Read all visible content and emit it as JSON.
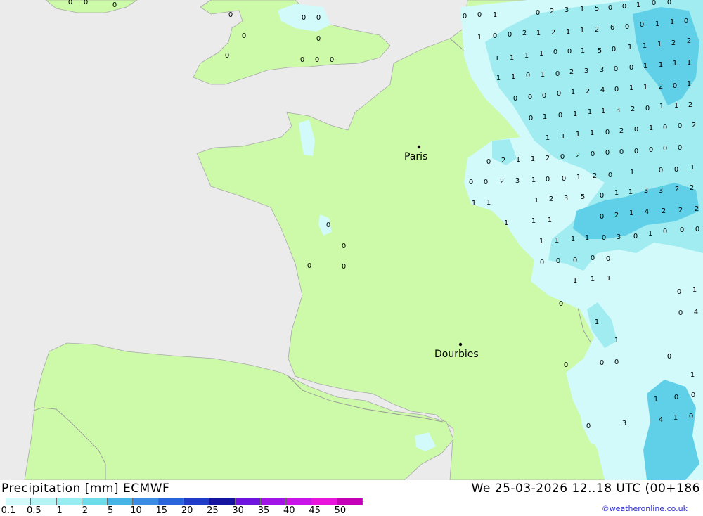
{
  "map": {
    "colors": {
      "sea": "#ebebeb",
      "land": "#ccfaa8",
      "precip_light": "#d2fafa",
      "precip_mid": "#a0ecf0",
      "precip_heavy": "#60d0e8",
      "border": "#9a9a9a"
    },
    "cities": [
      {
        "name": "Paris"
      },
      {
        "name": "Dourbies"
      }
    ]
  },
  "values": [
    "0",
    "0",
    "0",
    "0",
    "0",
    "0",
    "0",
    "0",
    "0",
    "0",
    "0",
    "0",
    "0",
    "0",
    "0",
    "0",
    "0",
    "0",
    "1",
    "0",
    "2",
    "3",
    "1",
    "5",
    "0",
    "0",
    "1",
    "0",
    "0",
    "1",
    "0",
    "0",
    "2",
    "1",
    "2",
    "1",
    "1",
    "2",
    "6",
    "0",
    "0",
    "1",
    "1",
    "0",
    "1",
    "1",
    "1",
    "1",
    "0",
    "0",
    "1",
    "5",
    "0",
    "1",
    "1",
    "1",
    "2",
    "2",
    "1",
    "1",
    "0",
    "1",
    "0",
    "2",
    "3",
    "3",
    "0",
    "0",
    "1",
    "1",
    "1",
    "1",
    "0",
    "0",
    "0",
    "0",
    "1",
    "2",
    "4",
    "0",
    "1",
    "1",
    "2",
    "0",
    "1",
    "0",
    "1",
    "0",
    "1",
    "1",
    "1",
    "3",
    "2",
    "0",
    "1",
    "1",
    "2",
    "1",
    "1",
    "1",
    "1",
    "0",
    "2",
    "0",
    "1",
    "0",
    "0",
    "2",
    "0",
    "2",
    "1",
    "1",
    "2",
    "0",
    "2",
    "0",
    "0",
    "0",
    "0",
    "0",
    "0",
    "0",
    "0",
    "0",
    "2",
    "3",
    "1",
    "0",
    "0",
    "1",
    "2",
    "0",
    "1",
    "0",
    "0",
    "1",
    "1",
    "1",
    "1",
    "2",
    "3",
    "5",
    "0",
    "1",
    "1",
    "3",
    "3",
    "2",
    "2",
    "1",
    "1",
    "1",
    "0",
    "2",
    "1",
    "4",
    "2",
    "2",
    "2",
    "1",
    "1",
    "1",
    "1",
    "0",
    "3",
    "0",
    "1",
    "0",
    "0",
    "0",
    "0",
    "0",
    "0",
    "0",
    "0",
    "1",
    "1",
    "1",
    "0",
    "0",
    "1",
    "0",
    "4",
    "1",
    "1",
    "0",
    "0",
    "0",
    "0",
    "1",
    "1",
    "0",
    "0",
    "0",
    "3",
    "4",
    "1",
    "0"
  ],
  "footer": {
    "title": "Precipitation [mm] ECMWF",
    "datetime": "We 25-03-2026 12..18 UTC (00+186",
    "credit": "©weatheronline.co.uk",
    "legend": {
      "labels": [
        "0.1",
        "0.5",
        "1",
        "2",
        "5",
        "10",
        "15",
        "20",
        "25",
        "30",
        "35",
        "40",
        "45",
        "50"
      ],
      "colors": [
        "#d2fafa",
        "#b4f4f4",
        "#96eef0",
        "#6edcea",
        "#46b4e6",
        "#3c8ce6",
        "#2864dc",
        "#1e3cc8",
        "#1414a0",
        "#6e14dc",
        "#a014e6",
        "#c814e6",
        "#e614dc",
        "#c400b4"
      ]
    }
  }
}
